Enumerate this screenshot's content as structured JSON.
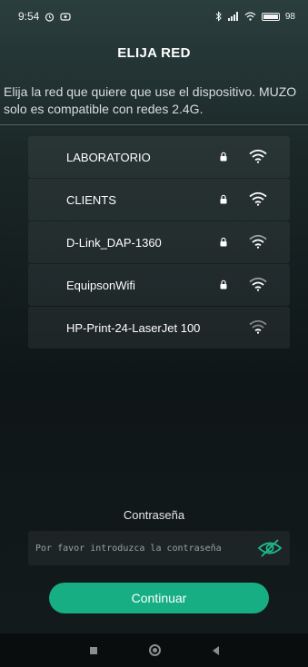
{
  "status_bar": {
    "time": "9:54",
    "left_icons": [
      "alarm-icon",
      "notification-icon"
    ],
    "right_icons": [
      "bluetooth-icon",
      "signal-icon",
      "wifi-icon",
      "battery-icon"
    ],
    "battery": "98"
  },
  "header": {
    "title": "ELIJA RED"
  },
  "description": "Elija la red que quiere que use el dispositivo. MUZO solo es compatible con redes 2.4G.",
  "networks": [
    {
      "name": "LABORATORIO",
      "locked": true,
      "icon": "wifi-icon"
    },
    {
      "name": "CLIENTS",
      "locked": true,
      "icon": "wifi-icon"
    },
    {
      "name": "D-Link_DAP-1360",
      "locked": true,
      "icon": "wifi-icon"
    },
    {
      "name": "EquipsonWifi",
      "locked": true,
      "icon": "wifi-icon"
    },
    {
      "name": "HP-Print-24-LaserJet 100",
      "locked": false,
      "icon": "wifi-icon"
    }
  ],
  "password": {
    "label": "Contraseña",
    "placeholder": "Por favor introduzca la contraseña",
    "value": "",
    "toggle_icon": "eye-off-icon"
  },
  "continue_button": {
    "label": "Continuar"
  },
  "colors": {
    "accent": "#16ae82",
    "eye_icon": "#1fb98c"
  },
  "nav_bar": {
    "icons": [
      "recent-apps-icon",
      "home-icon",
      "back-icon"
    ]
  }
}
